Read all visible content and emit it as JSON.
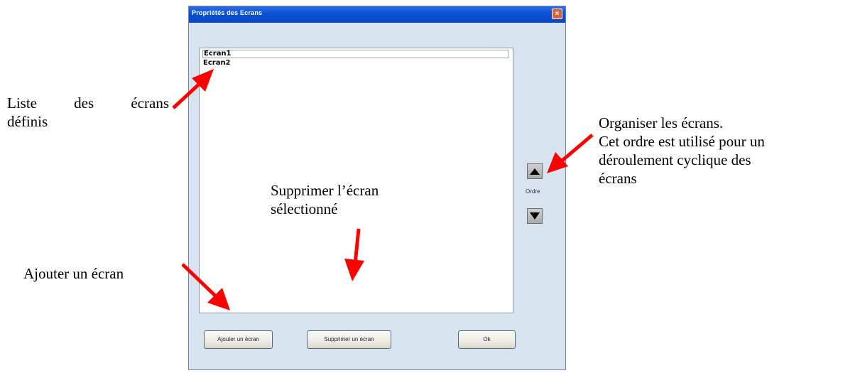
{
  "dialog": {
    "title": "Propriétés des Ecrans",
    "close_label": "×",
    "screens": [
      "Ecran1",
      "Ecran2"
    ],
    "order_label": "Ordre",
    "buttons": {
      "add": "Ajouter un écran",
      "remove": "Supprimer un écran",
      "ok": "Ok"
    }
  },
  "annotations": {
    "list_line1": "Liste des écrans",
    "list_line2": "définis",
    "organize_line1": "Organiser les écrans.",
    "organize_line2": "Cet ordre est utilisé pour un",
    "organize_line3": "déroulement cyclique des",
    "organize_line4": "écrans",
    "remove_line1": "Supprimer l’écran",
    "remove_line2": "sélectionné",
    "add": "Ajouter un écran"
  },
  "colors": {
    "titlebar": "#0a52d6",
    "dialog_bg": "#d8e3f0",
    "arrow": "#ff0000"
  },
  "icons": {
    "up": "triangle-up-icon",
    "down": "triangle-down-icon",
    "close": "close-icon"
  }
}
